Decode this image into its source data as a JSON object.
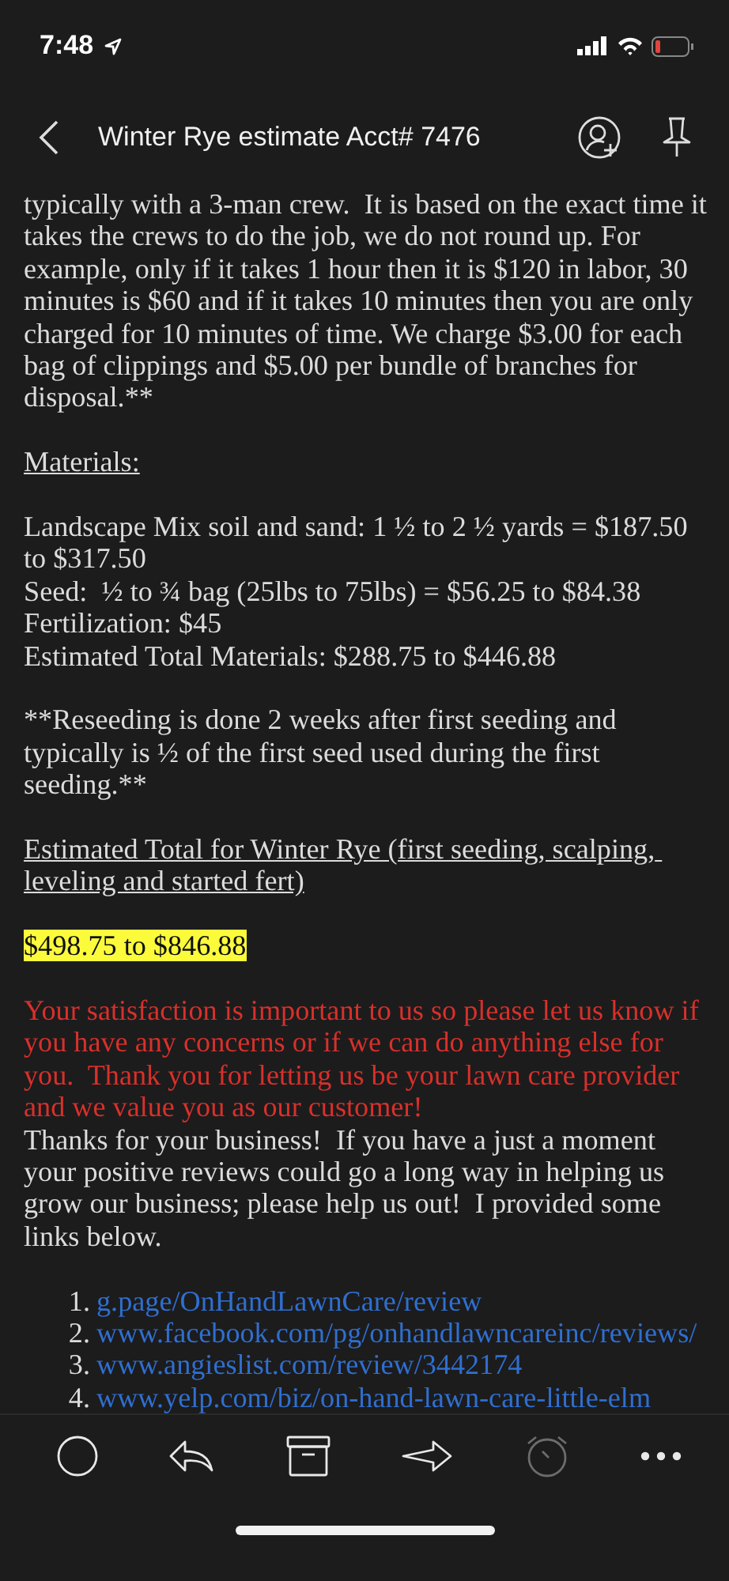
{
  "status_bar": {
    "time": "7:48"
  },
  "header": {
    "title": "Winter Rye estimate Acct# 7476"
  },
  "body": [
    {
      "kind": "paragraph",
      "text": "typically with a 3-man crew.  It is based on the exact time it takes the crews to do the job, we do not round up. For example, only if it takes 1 hour then it is $120 in labor, 30 minutes is $60 and if it takes 10 minutes then you are only charged for 10 minutes of time. We charge $3.00 for each bag of clippings and $5.00 per bundle of branches for disposal.**"
    },
    {
      "kind": "heading",
      "text": "Materials:"
    },
    {
      "kind": "lines",
      "lines": [
        "Landscape Mix soil and sand: 1 ½ to 2 ½ yards = $187.50 to $317.50",
        "Seed:  ½ to ¾ bag (25lbs to 75lbs) = $56.25 to $84.38",
        "Fertilization: $45",
        "Estimated Total Materials: $288.75 to $446.88"
      ]
    },
    {
      "kind": "paragraph",
      "text": "**Reseeding is done 2 weeks after first seeding and typically is ½ of the first seed used during the first seeding.**"
    },
    {
      "kind": "heading",
      "text": "Estimated Total for Winter Rye (first seeding, scalping, leveling and started fert)"
    },
    {
      "kind": "highlight",
      "text": "$498.75 to $846.88"
    },
    {
      "kind": "alert",
      "text": "Your satisfaction is important to us so please let us know if you have any concerns or if we can do anything else for you.  Thank you for letting us be your lawn care provider and we value you as our customer!"
    },
    {
      "kind": "paragraph",
      "text": "Thanks for your business!  If you have a just a moment your positive reviews could go a long way in helping us grow our business; please help us out!  I provided some links below."
    },
    {
      "kind": "links",
      "items": [
        {
          "number": "1.",
          "url": "g.page/OnHandLawnCare/review"
        },
        {
          "number": "2.",
          "url": "www.facebook.com/pg/onhandlawncareinc/reviews/"
        },
        {
          "number": "3.",
          "url": "www.angieslist.com/review/3442174"
        },
        {
          "number": "4.",
          "url": "www.yelp.com/biz/on-hand-lawn-care-little-elm"
        }
      ]
    }
  ],
  "toolbar": [
    {
      "kind": "circle",
      "disabled": false
    },
    {
      "kind": "reply",
      "disabled": false
    },
    {
      "kind": "archive",
      "disabled": false
    },
    {
      "kind": "forward",
      "disabled": false
    },
    {
      "kind": "snooze",
      "disabled": true
    },
    {
      "kind": "more",
      "disabled": false
    }
  ]
}
